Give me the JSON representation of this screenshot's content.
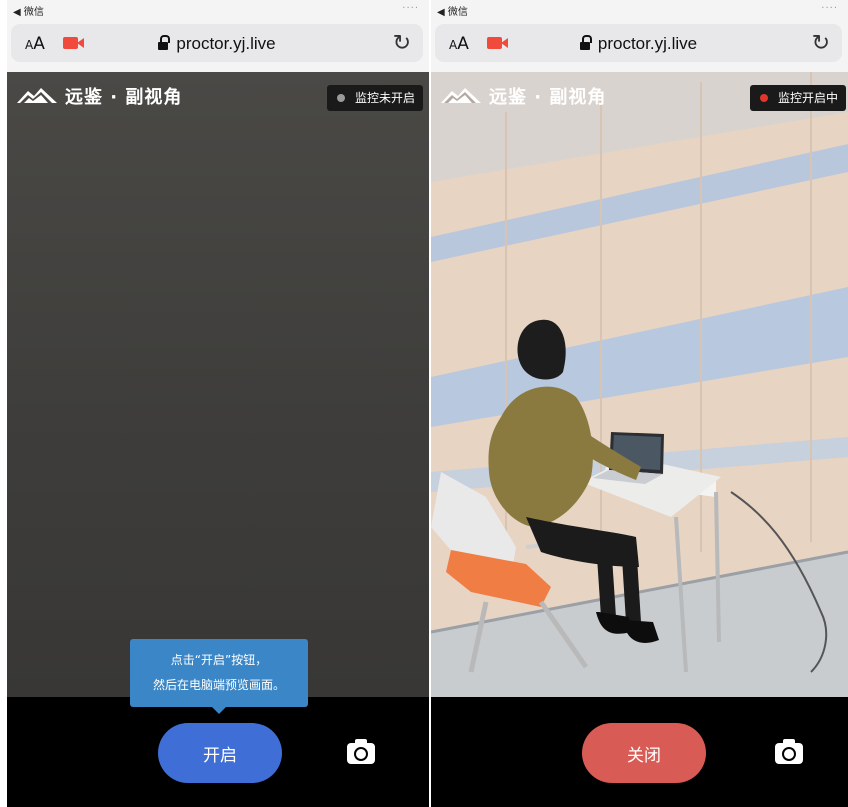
{
  "colors": {
    "open_button": "#3f6fd6",
    "close_button": "#d95b55",
    "tooltip": "#3a86c6",
    "status_off_dot": "#9a9a9a",
    "status_on_dot": "#e0362b",
    "camera_indicator": "#ef4a3c"
  },
  "left": {
    "statusbar": {
      "back_label": "◀ 微信",
      "right_hint": "····"
    },
    "browser": {
      "aa_small": "A",
      "aa_large": "A",
      "url": "proctor.yj.live",
      "reload_icon": "↻"
    },
    "header": {
      "brand": "远鉴 · 副视角",
      "monitor_status": "监控未开启"
    },
    "tooltip": {
      "line1": "点击“开启”按钮，",
      "line2": "然后在电脑端预览画面。"
    },
    "controls": {
      "primary_button": "开启",
      "switch_camera_icon": "camera-switch-icon"
    }
  },
  "right": {
    "statusbar": {
      "back_label": "◀ 微信",
      "right_hint": "····"
    },
    "browser": {
      "aa_small": "A",
      "aa_large": "A",
      "url": "proctor.yj.live",
      "reload_icon": "↻"
    },
    "header": {
      "brand": "远鉴 · 副视角",
      "monitor_status": "监控开启中"
    },
    "controls": {
      "primary_button": "关闭",
      "switch_camera_icon": "camera-switch-icon"
    }
  }
}
